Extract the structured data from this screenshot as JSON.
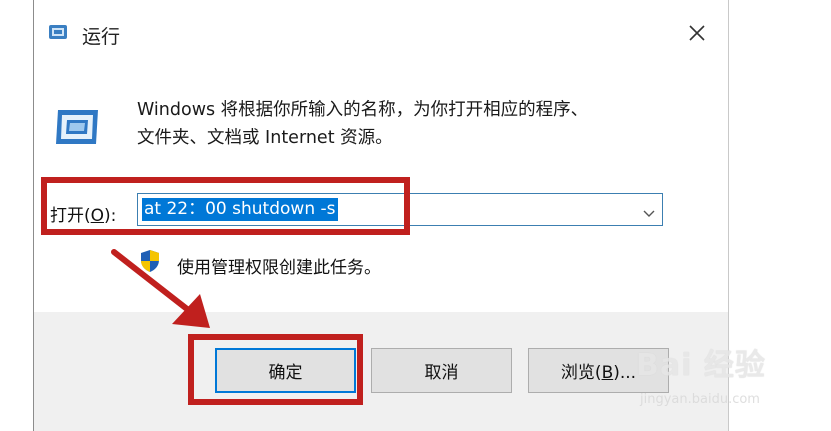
{
  "window": {
    "title": "运行",
    "description_line1": "Windows 将根据你所输入的名称，为你打开相应的程序、",
    "description_line2": "文件夹、文档或 Internet 资源。"
  },
  "open_field": {
    "label_prefix": "打开(",
    "label_key": "O",
    "label_suffix": "):",
    "value": "at 22：00 shutdown -s"
  },
  "admin_note": "使用管理权限创建此任务。",
  "buttons": {
    "ok": "确定",
    "cancel": "取消",
    "browse_prefix": "浏览(",
    "browse_key": "B",
    "browse_suffix": ")..."
  },
  "watermark": {
    "main": "Bai 经验",
    "sub": "jingyan.baidu.com"
  },
  "colors": {
    "highlight": "#c0201e",
    "selection": "#0078d7",
    "footer_bg": "#f0f0f0"
  },
  "icons": [
    "run-icon",
    "run-large-icon",
    "close-icon",
    "chevron-down-icon",
    "uac-shield-icon",
    "red-arrow-icon"
  ]
}
